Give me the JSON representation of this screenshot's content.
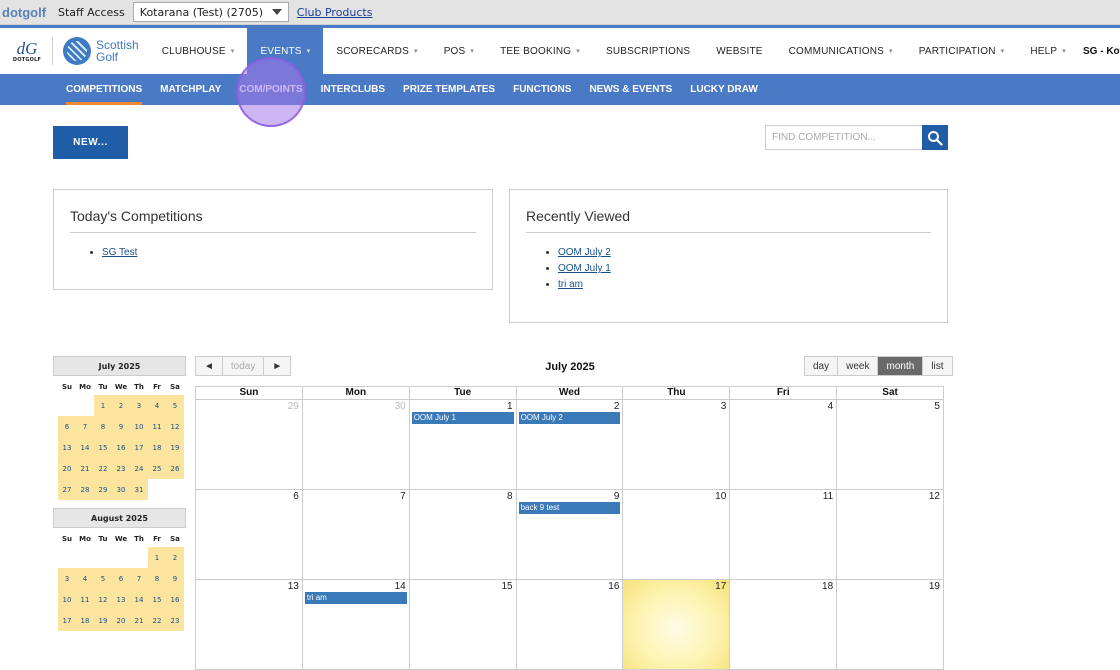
{
  "topbar": {
    "logo_text": "dotgolf",
    "staff_label": "Staff Access",
    "club_select_value": "Kotarana (Test) (2705)",
    "club_products_link": "Club Products"
  },
  "brand": {
    "dotgolf_text": "DOTGOLF",
    "sg_line1": "Scottish",
    "sg_line2": "Golf"
  },
  "nav": {
    "items": [
      {
        "label": "CLUBHOUSE",
        "dropdown": true
      },
      {
        "label": "EVENTS",
        "dropdown": true
      },
      {
        "label": "SCORECARDS",
        "dropdown": true
      },
      {
        "label": "POS",
        "dropdown": true
      },
      {
        "label": "TEE BOOKING",
        "dropdown": true
      },
      {
        "label": "SUBSCRIPTIONS",
        "dropdown": false
      },
      {
        "label": "WEBSITE",
        "dropdown": false
      },
      {
        "label": "COMMUNICATIONS",
        "dropdown": true
      },
      {
        "label": "PARTICIPATION",
        "dropdown": true
      },
      {
        "label": "HELP",
        "dropdown": true
      }
    ],
    "user_label": "SG - Kotarana ("
  },
  "subnav": {
    "items": [
      "COMPETITIONS",
      "MATCHPLAY",
      "COM/POINTS",
      "INTERCLUBS",
      "PRIZE TEMPLATES",
      "FUNCTIONS",
      "NEWS & EVENTS",
      "LUCKY DRAW"
    ]
  },
  "actions": {
    "new_label": "NEW...",
    "find_placeholder": "FIND COMPETITION..."
  },
  "todays": {
    "title": "Today's Competitions",
    "items": [
      "SG Test"
    ]
  },
  "recent": {
    "title": "Recently Viewed",
    "items": [
      "OOM July 2",
      "OOM July 1",
      "tri am"
    ]
  },
  "mini_july": {
    "title": "July 2025",
    "headers": [
      "Su",
      "Mo",
      "Tu",
      "We",
      "Th",
      "Fr",
      "Sa"
    ],
    "weeks": [
      [
        "",
        "",
        "1",
        "2",
        "3",
        "4",
        "5"
      ],
      [
        "6",
        "7",
        "8",
        "9",
        "10",
        "11",
        "12"
      ],
      [
        "13",
        "14",
        "15",
        "16",
        "17",
        "18",
        "19"
      ],
      [
        "20",
        "21",
        "22",
        "23",
        "24",
        "25",
        "26"
      ],
      [
        "27",
        "28",
        "29",
        "30",
        "31",
        "",
        ""
      ]
    ]
  },
  "mini_aug": {
    "title": "August 2025",
    "headers": [
      "Su",
      "Mo",
      "Tu",
      "We",
      "Th",
      "Fr",
      "Sa"
    ],
    "weeks": [
      [
        "",
        "",
        "",
        "",
        "",
        "1",
        "2"
      ],
      [
        "3",
        "4",
        "5",
        "6",
        "7",
        "8",
        "9"
      ],
      [
        "10",
        "11",
        "12",
        "13",
        "14",
        "15",
        "16"
      ],
      [
        "17",
        "18",
        "19",
        "20",
        "21",
        "22",
        "23"
      ]
    ]
  },
  "calendar": {
    "prev_label": "◄",
    "today_label": "today",
    "next_label": "►",
    "title": "July 2025",
    "views": [
      "day",
      "week",
      "month",
      "list"
    ],
    "active_view": "month",
    "day_headers": [
      "Sun",
      "Mon",
      "Tue",
      "Wed",
      "Thu",
      "Fri",
      "Sat"
    ],
    "weeks": [
      [
        {
          "n": "29",
          "other": true
        },
        {
          "n": "30",
          "other": true
        },
        {
          "n": "1",
          "event": "OOM July 1"
        },
        {
          "n": "2",
          "event": "OOM July 2"
        },
        {
          "n": "3"
        },
        {
          "n": "4"
        },
        {
          "n": "5"
        }
      ],
      [
        {
          "n": "6"
        },
        {
          "n": "7"
        },
        {
          "n": "8"
        },
        {
          "n": "9",
          "event": "back 9 test"
        },
        {
          "n": "10"
        },
        {
          "n": "11"
        },
        {
          "n": "12"
        }
      ],
      [
        {
          "n": "13"
        },
        {
          "n": "14",
          "event": "tri am"
        },
        {
          "n": "15"
        },
        {
          "n": "16"
        },
        {
          "n": "17",
          "today": true
        },
        {
          "n": "18"
        },
        {
          "n": "19"
        }
      ]
    ]
  },
  "colors": {
    "brand_blue": "#4a79c6",
    "button_blue": "#1f5ea6",
    "accent_orange": "#f08a37",
    "highlight_yellow": "#fbe49e"
  }
}
